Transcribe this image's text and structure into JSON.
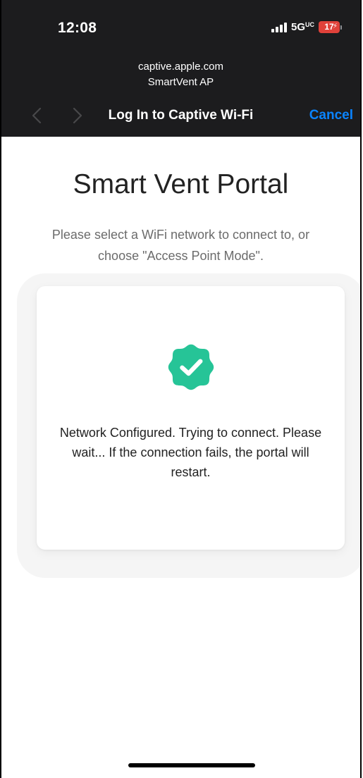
{
  "status_bar": {
    "time": "12:08",
    "network": "5G",
    "network_suffix": "UC",
    "battery_level": "17",
    "battery_color": "#e0413a"
  },
  "captive_header": {
    "host": "captive.apple.com",
    "ssid": "SmartVent AP",
    "title": "Log In to Captive Wi-Fi",
    "cancel_label": "Cancel",
    "back_icon": "chevron-left-icon",
    "forward_icon": "chevron-right-icon",
    "accent_color": "#0a84ff"
  },
  "portal": {
    "title": "Smart Vent Portal",
    "subtitle": "Please select a WiFi network to connect to, or choose \"Access Point Mode\".",
    "status_icon": "verified-check-icon",
    "status_icon_color": "#26c497",
    "message": "Network Configured. Trying to connect. Please wait... If the connection fails, the portal will restart."
  }
}
